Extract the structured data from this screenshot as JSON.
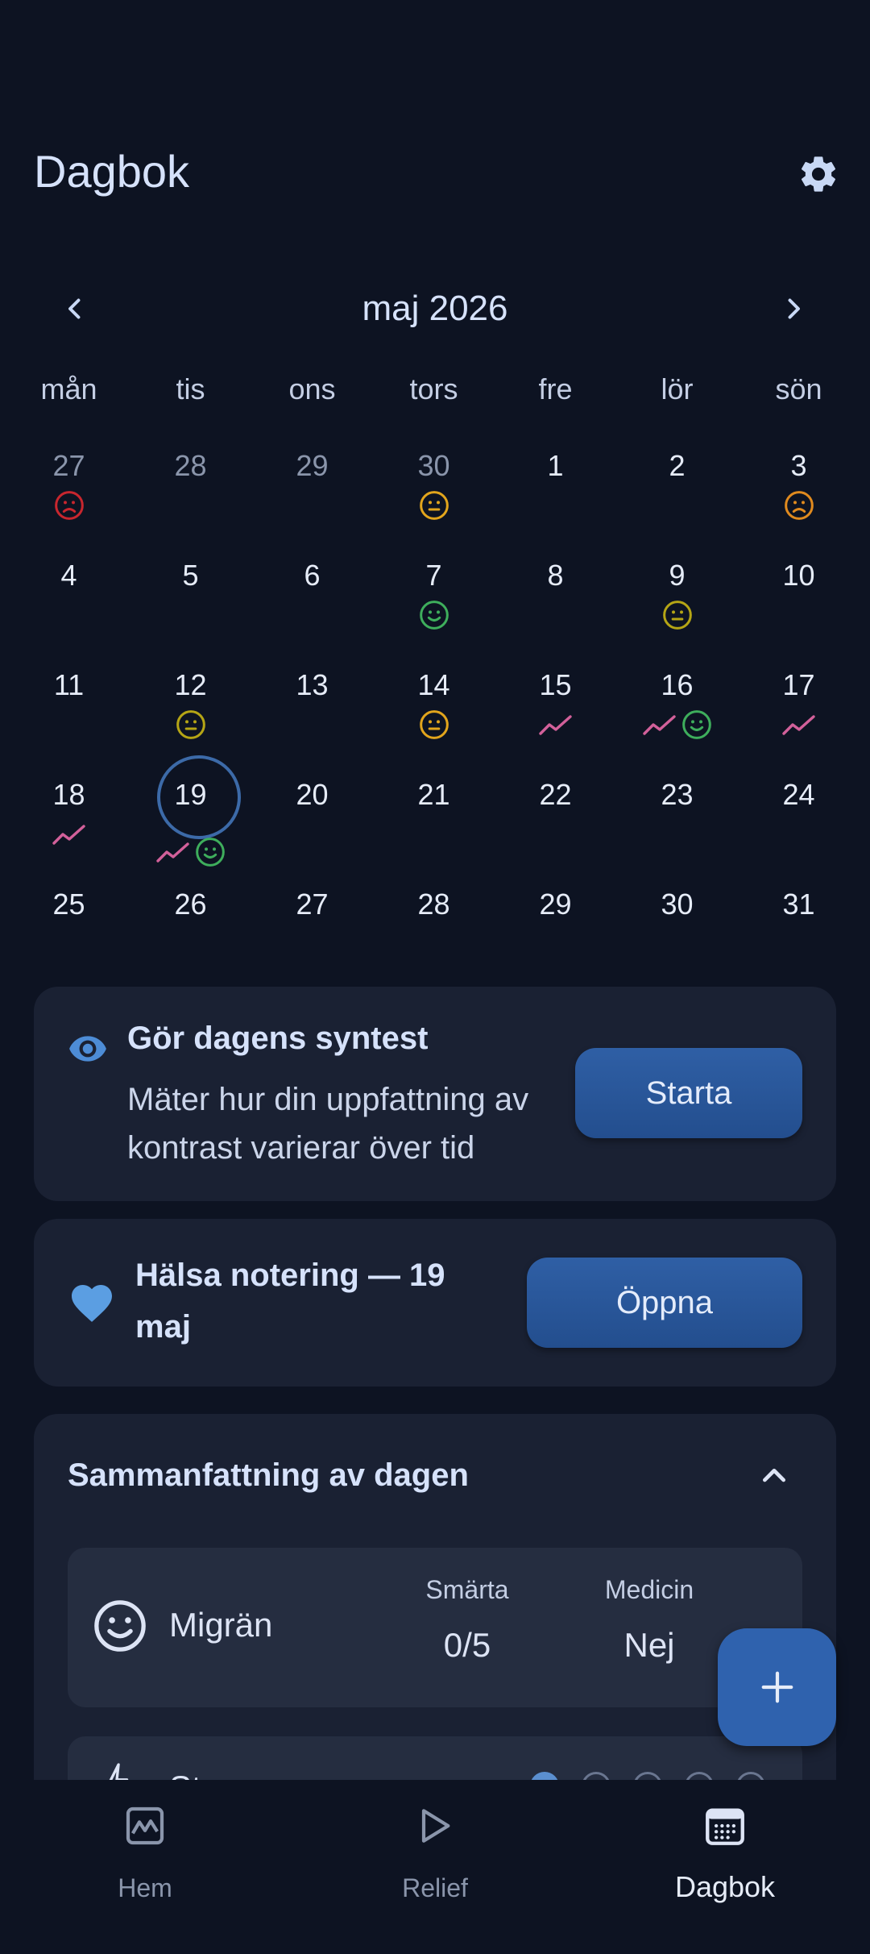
{
  "header": {
    "title": "Dagbok",
    "settings_icon": "gear-icon"
  },
  "calendar": {
    "month_label": "maj 2026",
    "weekdays": [
      "mån",
      "tis",
      "ons",
      "tors",
      "fre",
      "lör",
      "sön"
    ],
    "weeks": [
      [
        {
          "day": "27",
          "muted": true,
          "icons": [
            "sad-red"
          ]
        },
        {
          "day": "28",
          "muted": true,
          "icons": []
        },
        {
          "day": "29",
          "muted": true,
          "icons": []
        },
        {
          "day": "30",
          "muted": true,
          "icons": [
            "neutral-yellow"
          ]
        },
        {
          "day": "1",
          "icons": []
        },
        {
          "day": "2",
          "icons": []
        },
        {
          "day": "3",
          "icons": [
            "sad-orange"
          ]
        }
      ],
      [
        {
          "day": "4",
          "icons": []
        },
        {
          "day": "5",
          "icons": []
        },
        {
          "day": "6",
          "icons": []
        },
        {
          "day": "7",
          "icons": [
            "happy-green"
          ]
        },
        {
          "day": "8",
          "icons": []
        },
        {
          "day": "9",
          "icons": [
            "neutral-olive"
          ]
        },
        {
          "day": "10",
          "icons": []
        }
      ],
      [
        {
          "day": "11",
          "icons": []
        },
        {
          "day": "12",
          "icons": [
            "neutral-olive"
          ]
        },
        {
          "day": "13",
          "icons": []
        },
        {
          "day": "14",
          "icons": [
            "neutral-yellow"
          ]
        },
        {
          "day": "15",
          "icons": [
            "trend"
          ]
        },
        {
          "day": "16",
          "icons": [
            "trend",
            "happy-green"
          ]
        },
        {
          "day": "17",
          "icons": [
            "trend"
          ]
        }
      ],
      [
        {
          "day": "18",
          "icons": [
            "trend"
          ]
        },
        {
          "day": "19",
          "today": true,
          "icons": [
            "trend",
            "happy-green"
          ]
        },
        {
          "day": "20",
          "icons": []
        },
        {
          "day": "21",
          "icons": []
        },
        {
          "day": "22",
          "icons": []
        },
        {
          "day": "23",
          "icons": []
        },
        {
          "day": "24",
          "icons": []
        }
      ],
      [
        {
          "day": "25",
          "icons": []
        },
        {
          "day": "26",
          "icons": []
        },
        {
          "day": "27",
          "icons": []
        },
        {
          "day": "28",
          "icons": []
        },
        {
          "day": "29",
          "icons": []
        },
        {
          "day": "30",
          "icons": []
        },
        {
          "day": "31",
          "icons": []
        }
      ]
    ]
  },
  "synthesis_card": {
    "title": "Gör dagens syntest",
    "description": "Mäter hur din uppfattning av kontrast varierar över tid",
    "button_label": "Starta"
  },
  "health_card": {
    "title": "Hälsa notering — 19 maj",
    "button_label": "Öppna"
  },
  "summary": {
    "title": "Sammanfattning av dagen",
    "item": {
      "name": "Migrän",
      "pain_label": "Smärta",
      "pain_value": "0/5",
      "medicine_label": "Medicin",
      "medicine_value": "Nej"
    },
    "item2": {
      "name": "St",
      "level": 1,
      "level_max": 5
    }
  },
  "colors": {
    "accent": "#2f62ae",
    "sad_red": "#c8262e",
    "neutral_yellow": "#e2a51c",
    "sad_orange": "#e08a1e",
    "happy_green": "#3eae5c",
    "neutral_olive": "#b5a515",
    "trend_pink": "#d2609a"
  },
  "nav": {
    "items": [
      {
        "label": "Hem",
        "icon": "chart-image-icon"
      },
      {
        "label": "Relief",
        "icon": "play-icon"
      },
      {
        "label": "Dagbok",
        "icon": "calendar-icon",
        "active": true
      }
    ]
  }
}
